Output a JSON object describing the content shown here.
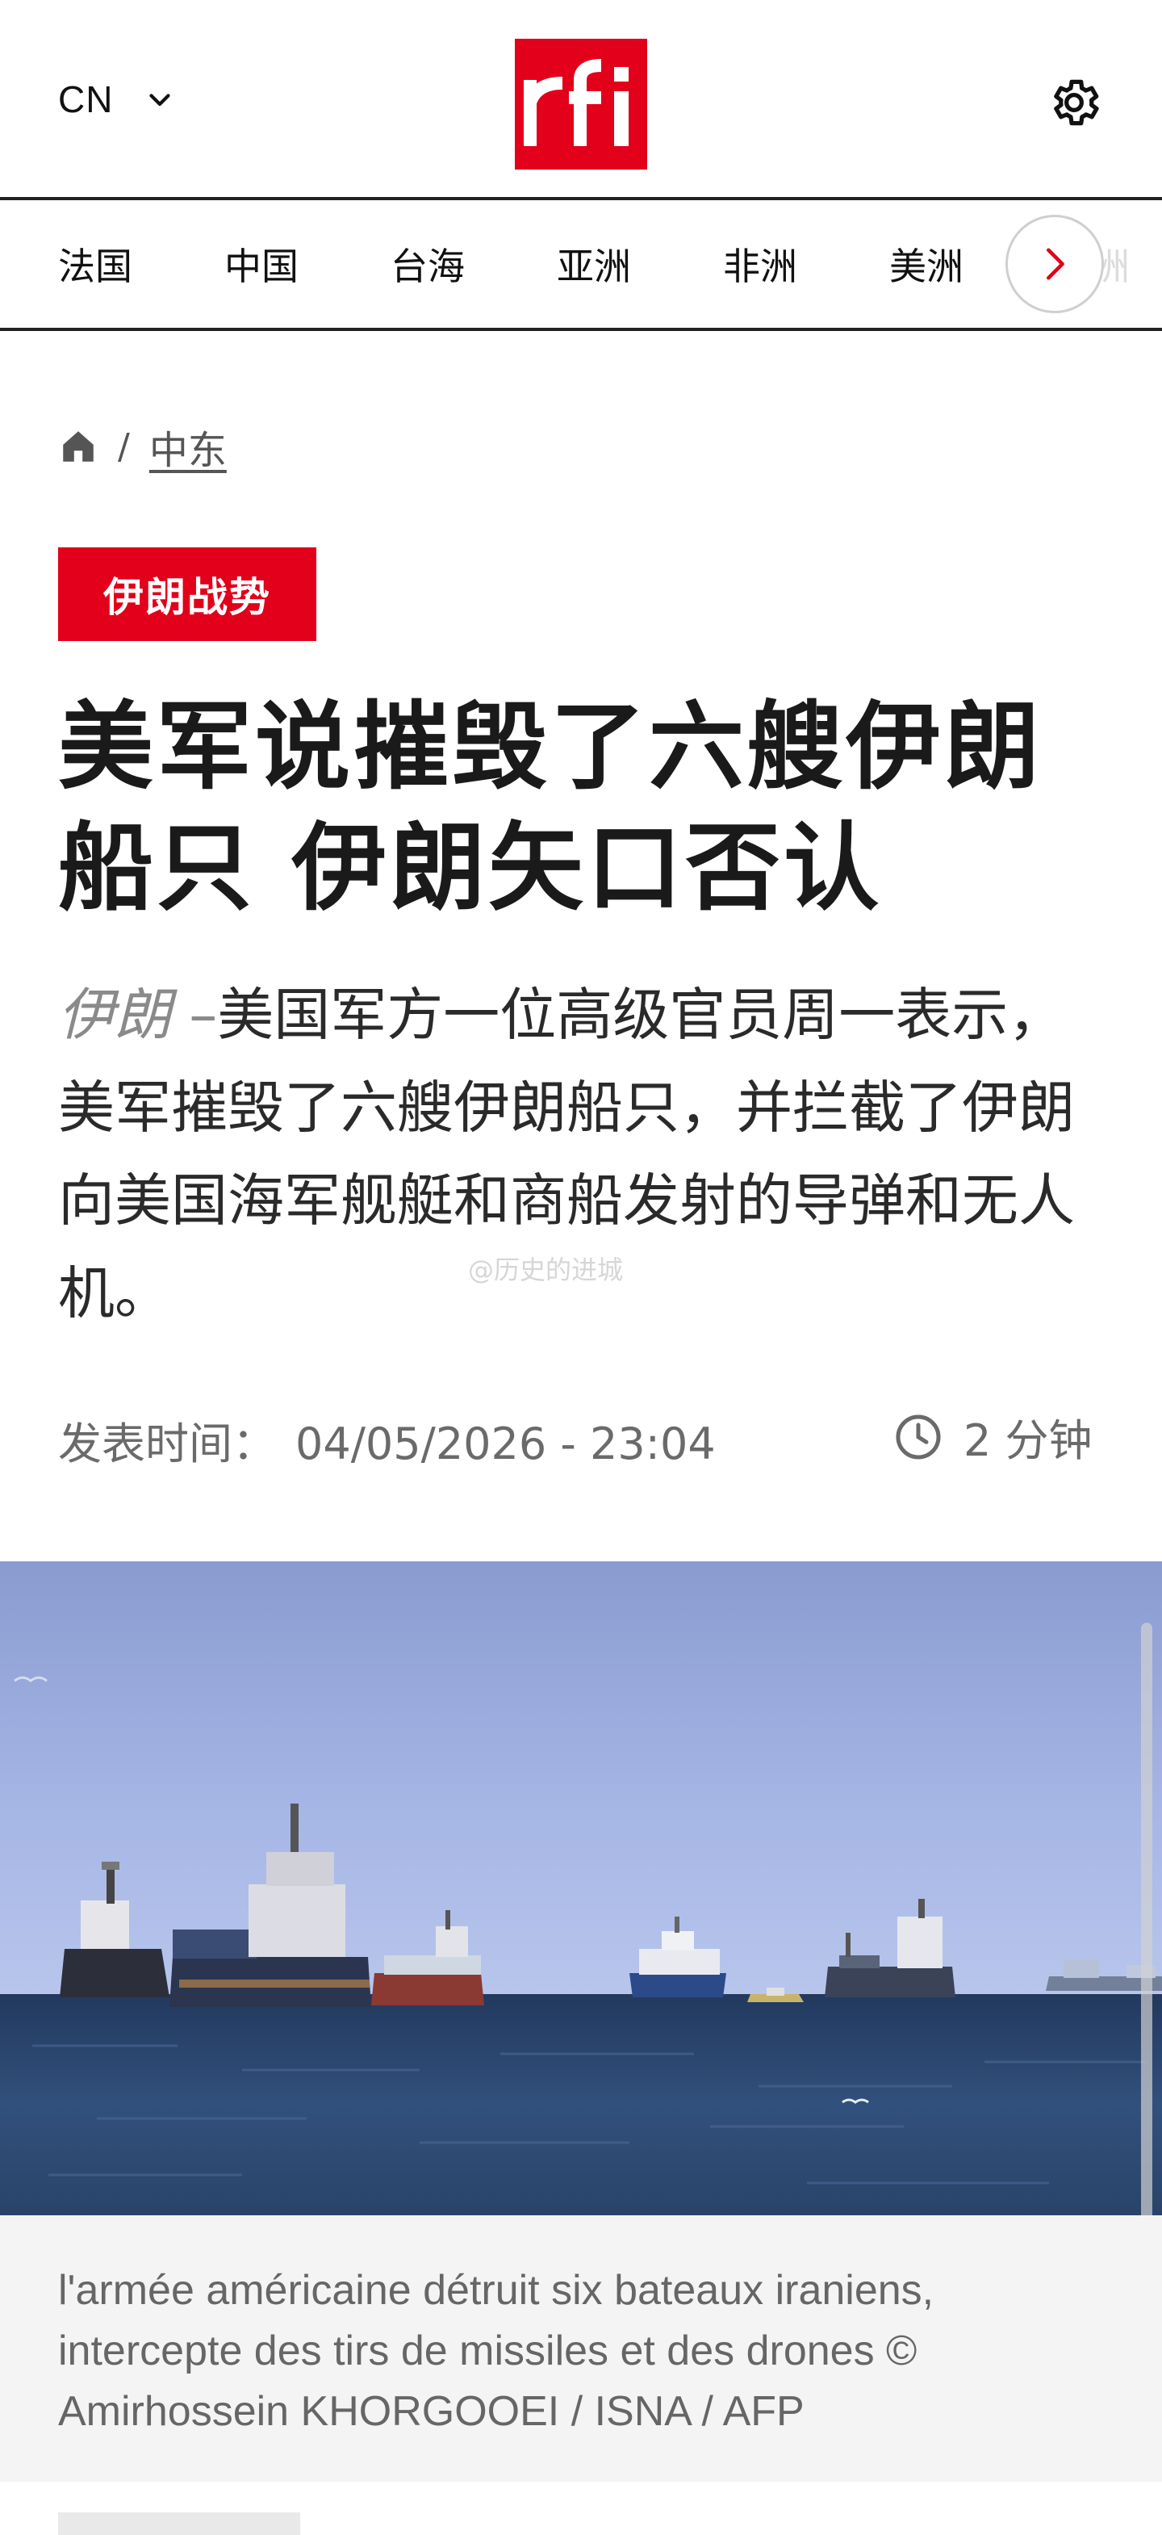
{
  "header": {
    "lang_code": "CN",
    "logo_text": "rfi",
    "brand_color": "#e2001a",
    "icons": {
      "language_dropdown": "chevron-down-icon",
      "settings": "gear-icon"
    }
  },
  "nav": {
    "items": [
      "法国",
      "中国",
      "台海",
      "亚洲",
      "非洲",
      "美洲",
      "欧洲"
    ],
    "next_icon": "chevron-right-icon"
  },
  "breadcrumb": {
    "home_icon": "home-icon",
    "separator": "/",
    "section": "中东"
  },
  "article": {
    "tag": "伊朗战势",
    "title": "美军说摧毁了六艘伊朗船只 伊朗矢口否认",
    "lead_location": "伊朗",
    "lead_dash": "–",
    "lead_text": "美国军方一位高级官员周一表示，美军摧毁了六艘伊朗船只，并拦截了伊朗向美国海军舰艇和商船发射的导弹和无人机。",
    "published_label": "发表时间：",
    "published_value": "04/05/2026 - 23:04",
    "read_time": "2 分钟",
    "read_time_icon": "clock-icon"
  },
  "photo": {
    "caption": "l'armée américaine détruit six bateaux iraniens, intercepte des tirs de missiles et des drones © Amirhossein KHORGOOEI / ISNA / AFP"
  },
  "watermark": "@历史的进城"
}
